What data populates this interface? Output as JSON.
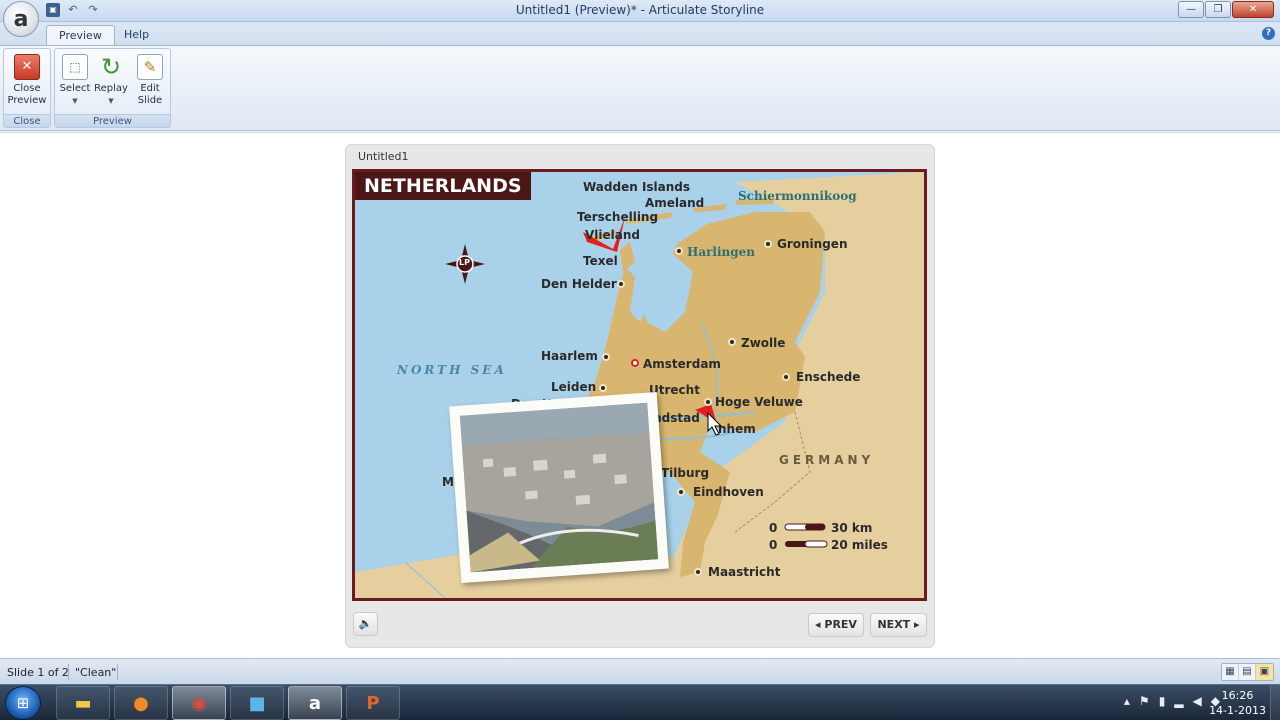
{
  "window": {
    "title": "Untitled1 (Preview)* -  Articulate Storyline",
    "logo_letter": "a",
    "controls": {
      "minimize": "—",
      "maximize": "❐",
      "close": "✕"
    }
  },
  "quick_access": {
    "save_icon": "save-icon",
    "undo_icon": "undo-icon",
    "redo_icon": "redo-icon"
  },
  "ribbon": {
    "tabs": [
      "Preview",
      "Help"
    ],
    "active_tab": "Preview",
    "help_glyph": "?",
    "groups": {
      "close": {
        "label": "Close",
        "buttons": {
          "close_preview_line1": "Close",
          "close_preview_line2": "Preview"
        }
      },
      "preview": {
        "label": "Preview",
        "buttons": {
          "select": "Select",
          "replay": "Replay",
          "edit_line1": "Edit",
          "edit_line2": "Slide"
        }
      }
    }
  },
  "player": {
    "title": "Untitled1",
    "prev_label": "◂ PREV",
    "next_label": "NEXT ▸",
    "volume_glyph": "🔈"
  },
  "slide": {
    "map_title": "NETHERLANDS",
    "islands": [
      "Wadden Islands",
      "Ameland",
      "Schiermonnikoog",
      "Terschelling",
      "Vlieland",
      "Texel"
    ],
    "cities": {
      "den_helder": "Den Helder",
      "harlingen": "Harlingen",
      "groningen": "Groningen",
      "zwolle": "Zwolle",
      "haarlem": "Haarlem",
      "amsterdam": "Amsterdam",
      "enschede": "Enschede",
      "leiden": "Leiden",
      "utrecht": "Utrecht",
      "den_haag": "Den Haag",
      "hoge_veluwe": "Hoge Veluwe",
      "randstad": "andstad",
      "arnhem": "nhem",
      "tilburg": "Tilburg",
      "eindhoven": "Eindhoven",
      "maastricht": "Maastricht",
      "partial_mi": "Mi",
      "partial_m": "m"
    },
    "sea_label": "NORTH SEA",
    "country_label": "GERMANY",
    "scale": {
      "km": "0        30 km",
      "miles": "0        20 miles",
      "km_value": "30 km",
      "miles_value": "20 miles",
      "zero": "0"
    },
    "compass_text": "LP"
  },
  "statusbar": {
    "slide_info": "Slide 1 of 2",
    "theme": "\"Clean\""
  },
  "taskbar": {
    "apps": [
      "explorer-icon",
      "firefox-icon",
      "chrome-icon",
      "twitter-icon",
      "storyline-icon",
      "powerpoint-icon"
    ],
    "time": "16:26",
    "date": "14-1-2013"
  },
  "colors": {
    "map_border": "#6b1a1f",
    "title_bg": "#4a1616",
    "land": "#d9b66f",
    "sea": "#a9d2ea",
    "marker": "#e0211f"
  }
}
